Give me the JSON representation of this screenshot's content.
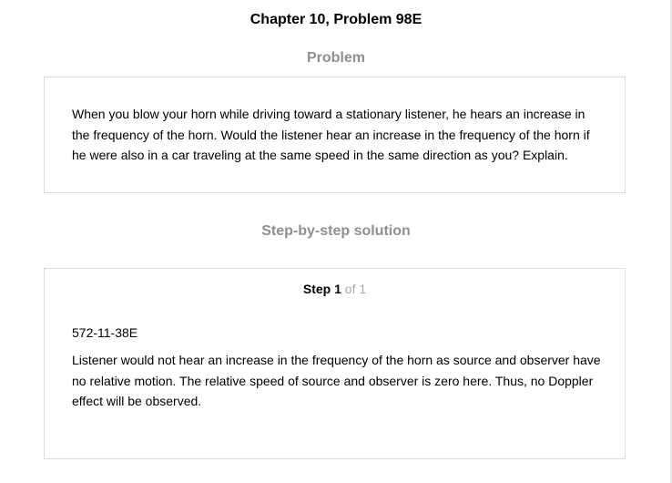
{
  "page": {
    "title": "Chapter 10, Problem 98E"
  },
  "problem": {
    "heading": "Problem",
    "text": "When you blow your horn while driving toward a stationary listener, he hears an increase in the frequency of the horn. Would the listener hear an increase in the frequency of the horn if he were also in a car traveling at the same speed in the same direction as you? Explain."
  },
  "solution": {
    "heading": "Step-by-step solution",
    "step": {
      "word": "Step",
      "number": "1",
      "of_text": "of 1"
    },
    "code": "572-11-38E",
    "text": "Listener would not hear an increase in the frequency of the horn as source and observer have no relative motion. The relative speed of source and observer is zero here. Thus, no Doppler effect will be observed."
  },
  "colors": {
    "heading_gray": "#8f8f8f",
    "border": "#dcdcdc",
    "step_of_gray": "#a8a8a8"
  }
}
